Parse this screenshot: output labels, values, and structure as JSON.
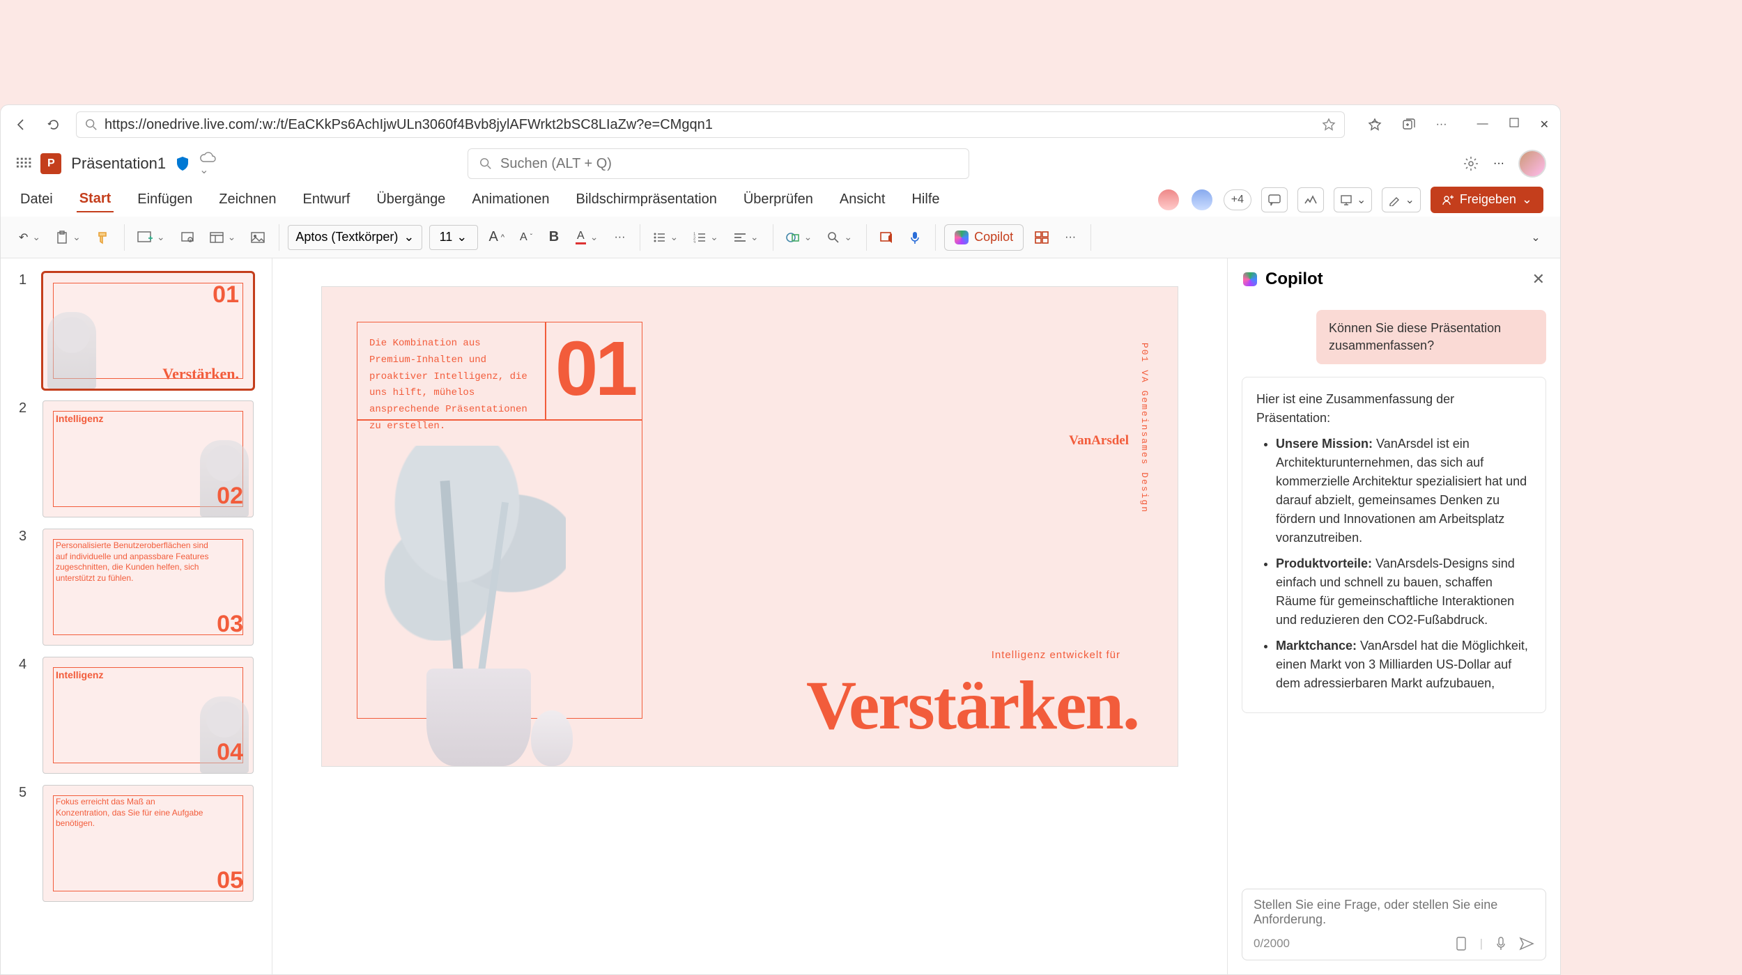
{
  "browser": {
    "url": "https://onedrive.live.com/:w:/t/EaCKkPs6AchIjwULn3060f4Bvb8jylAFWrkt2bSC8LIaZw?e=CMgqn1"
  },
  "app": {
    "file_name": "Präsentation1",
    "search_placeholder": "Suchen (ALT + Q)"
  },
  "ribbon": {
    "tabs": [
      "Datei",
      "Start",
      "Einfügen",
      "Zeichnen",
      "Entwurf",
      "Übergänge",
      "Animationen",
      "Bildschirmpräsentation",
      "Überprüfen",
      "Ansicht",
      "Hilfe"
    ],
    "active_tab": "Start",
    "presence_extra": "+4",
    "share_label": "Freigeben",
    "font_name": "Aptos (Textkörper)",
    "font_size": "11",
    "copilot_label": "Copilot"
  },
  "slides": [
    {
      "num": "1",
      "thumb_title": "Verstärken.",
      "big": "01"
    },
    {
      "num": "2",
      "thumb_title": "Intelligenz",
      "big": "02"
    },
    {
      "num": "3",
      "thumb_title": "Personalisierte Benutzerober­flächen sind auf individuelle und anpassbare Features zugeschnitten, die Kunden helfen, sich unterstützt zu fühlen.",
      "big": "03"
    },
    {
      "num": "4",
      "thumb_title": "Intelligenz",
      "big": "04"
    },
    {
      "num": "5",
      "thumb_title": "Fokus erreicht das Maß an Konzentration, das Sie für eine Aufgabe benötigen.",
      "big": "05"
    }
  ],
  "main_slide": {
    "desc": "Die Kombination aus Premium-Inhalten und proaktiver Intelligenz, die uns hilft, mühelos ansprechende Präsentationen zu erstellen.",
    "num": "01",
    "brand": "VanArsdel",
    "tagline": "Intelligenz entwickelt für",
    "headline": "Verstärken.",
    "side": "P01  VA  Gemeinsames  Design"
  },
  "copilot": {
    "title": "Copilot",
    "user_msg": "Können Sie diese Präsentation zusammenfassen?",
    "summary_intro": "Hier ist eine Zusammenfassung der Präsentation:",
    "bullets": [
      {
        "label": "Unsere Mission:",
        "text": " VanArsdel ist ein Architekturunternehmen, das sich auf kommerzielle Architektur spezialisiert hat und darauf abzielt, gemeinsames Denken zu fördern und Innovationen am Arbeitsplatz voranzutreiben."
      },
      {
        "label": "Produktvorteile:",
        "text": " VanArsdels-Designs sind einfach und schnell zu bauen, schaffen Räume für gemeinschaftliche Interaktionen und reduzieren den CO2-Fußabdruck."
      },
      {
        "label": "Marktchance:",
        "text": " VanArsdel hat die Möglichkeit, einen Markt von 3 Milliarden US-Dollar auf dem adressierbaren Markt aufzubauen,"
      }
    ],
    "input_placeholder": "Stellen Sie eine Frage, oder stellen Sie eine Anforderung.",
    "counter": "0/2000"
  }
}
